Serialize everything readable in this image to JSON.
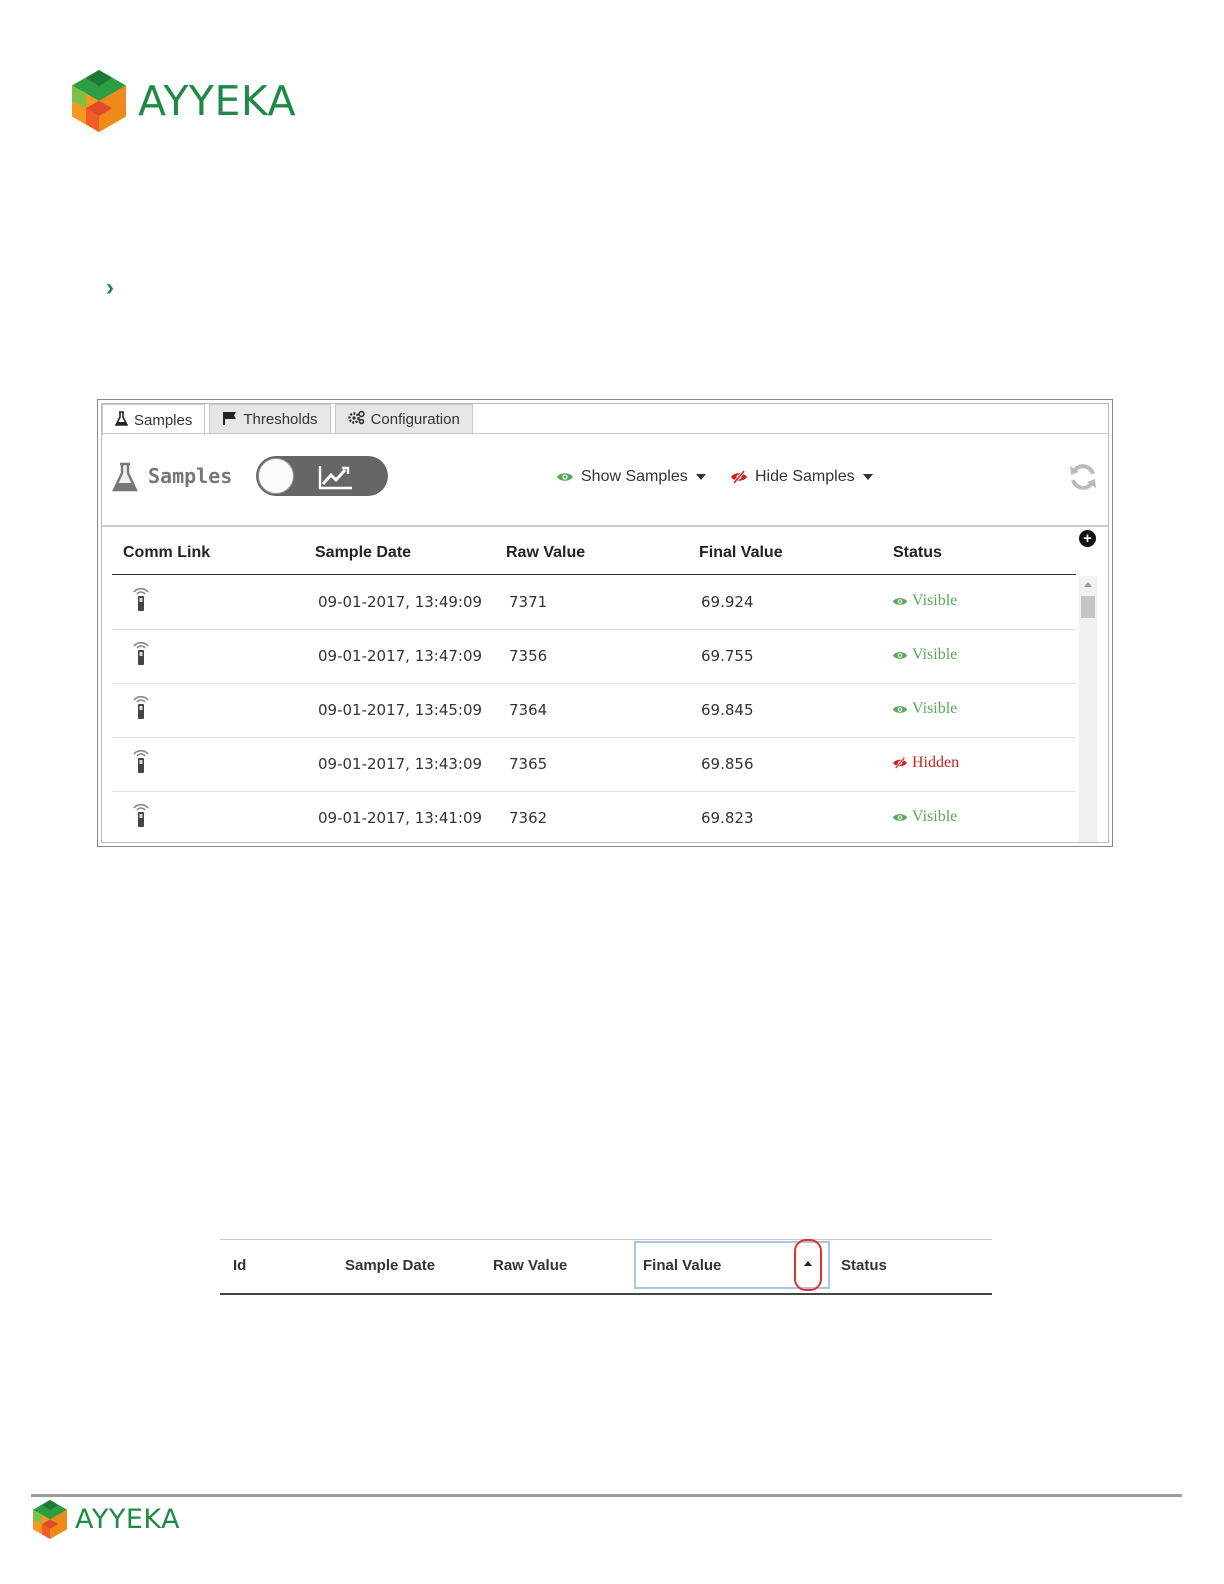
{
  "brand": {
    "name": "AYYEKA",
    "color": "#1e8a45"
  },
  "tabs": [
    {
      "label": "Samples",
      "icon": "flask-icon"
    },
    {
      "label": "Thresholds",
      "icon": "flag-icon"
    },
    {
      "label": "Configuration",
      "icon": "gears-icon"
    }
  ],
  "toolbar": {
    "title": "Samples",
    "show_label": "Show Samples",
    "hide_label": "Hide Samples"
  },
  "table": {
    "columns": [
      "Comm Link",
      "Sample Date",
      "Raw Value",
      "Final Value",
      "Status"
    ],
    "rows": [
      {
        "date": "09-01-2017, 13:49:09",
        "raw": "7371",
        "final": "69.924",
        "status": "Visible"
      },
      {
        "date": "09-01-2017, 13:47:09",
        "raw": "7356",
        "final": "69.755",
        "status": "Visible"
      },
      {
        "date": "09-01-2017, 13:45:09",
        "raw": "7364",
        "final": "69.845",
        "status": "Visible"
      },
      {
        "date": "09-01-2017, 13:43:09",
        "raw": "7365",
        "final": "69.856",
        "status": "Hidden"
      },
      {
        "date": "09-01-2017, 13:41:09",
        "raw": "7362",
        "final": "69.823",
        "status": "Visible"
      }
    ]
  },
  "header_snippet": {
    "columns": [
      "Id",
      "Sample Date",
      "Raw Value",
      "Final Value",
      "Status"
    ]
  },
  "colors": {
    "visible": "#5aa75a",
    "hidden": "#cc2222",
    "highlight": "#a9c4e6",
    "sort_circle": "#e03030"
  }
}
